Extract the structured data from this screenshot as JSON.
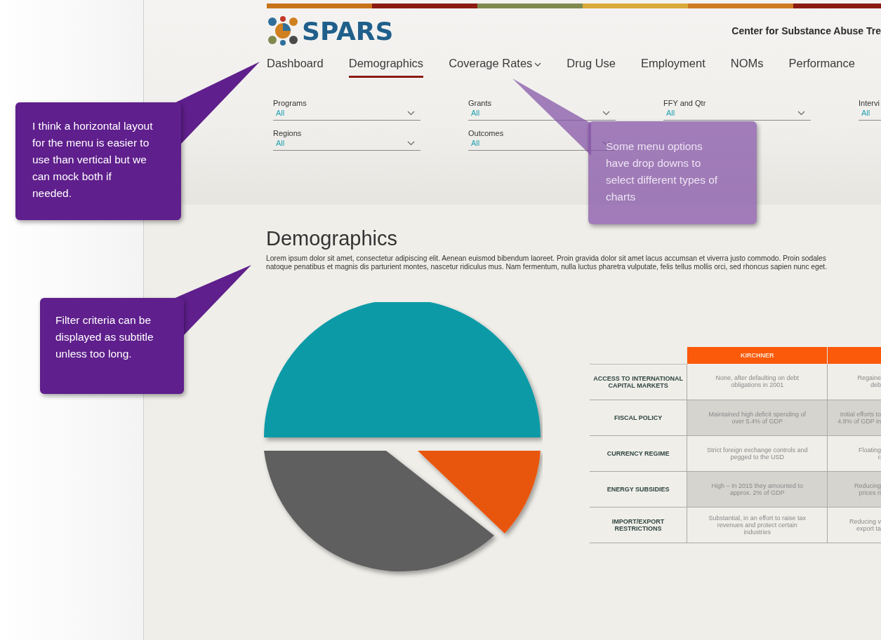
{
  "header": {
    "logo": "SPARS",
    "agency": "Center for Substance Abuse Tre"
  },
  "nav": [
    {
      "label": "Dashboard",
      "selected": false,
      "dropdown": false
    },
    {
      "label": "Demographics",
      "selected": true,
      "dropdown": false
    },
    {
      "label": "Coverage Rates",
      "selected": false,
      "dropdown": true
    },
    {
      "label": "Drug Use",
      "selected": false,
      "dropdown": false
    },
    {
      "label": "Employment",
      "selected": false,
      "dropdown": false
    },
    {
      "label": "NOMs",
      "selected": false,
      "dropdown": false
    },
    {
      "label": "Performance",
      "selected": false,
      "dropdown": false
    }
  ],
  "filters": [
    {
      "label": "Programs",
      "value": "All"
    },
    {
      "label": "Grants",
      "value": "All"
    },
    {
      "label": "FFY and Qtr",
      "value": "All"
    },
    {
      "label": "Intervi",
      "value": "All"
    },
    {
      "label": "Regions",
      "value": "All"
    },
    {
      "label": "Outcomes",
      "value": "All"
    }
  ],
  "page": {
    "title": "Demographics",
    "description_lines": [
      "Lorem ipsum dolor sit amet, consectetur adipiscing elit. Aenean euismod bibendum laoreet. Proin gravida dolor sit amet lacus accumsan et viverra justo commodo. Proin sodales",
      "natoque penatibus et magnis dis parturient montes, nascetur ridiculus mus. Nam fermentum, nulla luctus pharetra vulputate, felis tellus mollis orci, sed rhoncus sapien nunc eget."
    ]
  },
  "table": {
    "columns": [
      "KIRCHNER"
    ],
    "rows": [
      {
        "label": "ACCESS TO INTERNATIONAL CAPITAL MARKETS",
        "cells": [
          "None, after defaulting on debt obligations in 2001"
        ],
        "cut_cell": [
          "Regaine",
          "deb"
        ]
      },
      {
        "label": "FISCAL POLICY",
        "cells": [
          "Maintained high deficit spending of over 5.4% of GDP"
        ],
        "cut_cell": [
          "Initial efforts to",
          "4.8% of GDP in"
        ]
      },
      {
        "label": "CURRENCY REGIME",
        "cells": [
          "Strict foreign exchange controls and pegged to the USD"
        ],
        "cut_cell": [
          "Floating",
          "c"
        ]
      },
      {
        "label": "ENERGY SUBSIDIES",
        "cells": [
          "High – In 2015 they amounted to approx. 2% of GDP"
        ],
        "cut_cell": [
          "Reducing",
          "prices ri"
        ]
      },
      {
        "label": "IMPORT/EXPORT RESTRICTIONS",
        "cells": [
          "Substantial, in an effort to raise tax revenues and protect certain industries"
        ],
        "cut_cell": [
          "Reducing v",
          "export ta"
        ]
      }
    ]
  },
  "annotations": [
    {
      "text": "I think a horizontal layout for the menu is easier to use than vertical but we can mock both if needed.",
      "translucent": false
    },
    {
      "text": "Some menu options have drop downs to select different types of charts",
      "translucent": true
    },
    {
      "text": "Filter criteria can be displayed as subtitle unless too long.",
      "translucent": false
    }
  ]
}
